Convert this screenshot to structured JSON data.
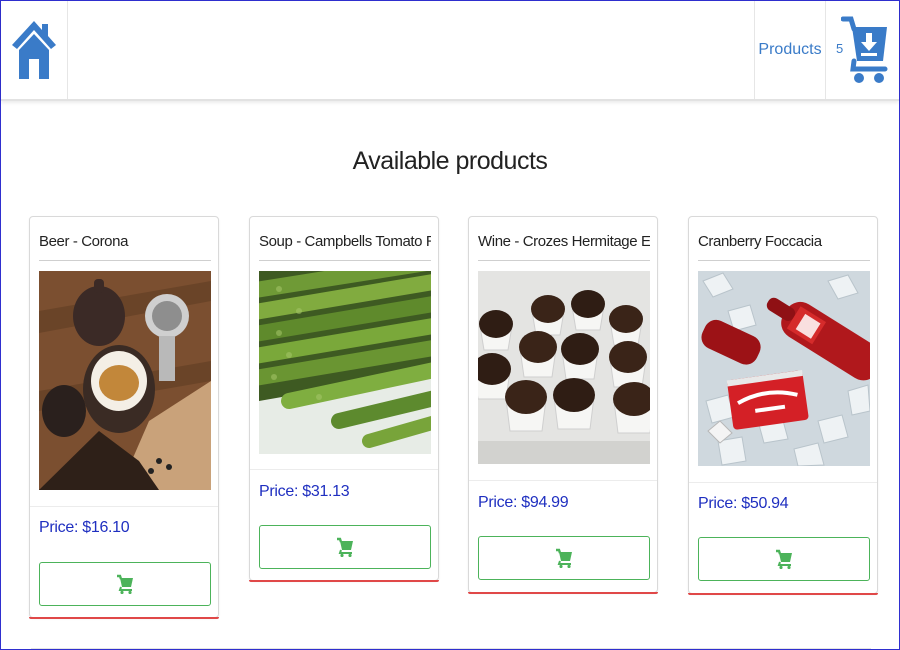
{
  "nav": {
    "home_icon": "home-icon",
    "products_label": "Products",
    "cart_count": "5",
    "cart_icon": "cart-download-icon"
  },
  "page": {
    "title": "Available products"
  },
  "products": [
    {
      "name": "Beer - Corona",
      "price": "Price: $16.10"
    },
    {
      "name": "Soup - Campbells Tomato Ravioli",
      "price": "Price: $31.13"
    },
    {
      "name": "Wine - Crozes Hermitage E.",
      "price": "Price: $94.99"
    },
    {
      "name": "Cranberry Foccacia",
      "price": "Price: $50.94"
    }
  ],
  "colors": {
    "brand_blue": "#3a7bc8",
    "price_blue": "#1f2fc0",
    "add_green": "#4cb35a",
    "card_accent_red": "#e04848"
  }
}
